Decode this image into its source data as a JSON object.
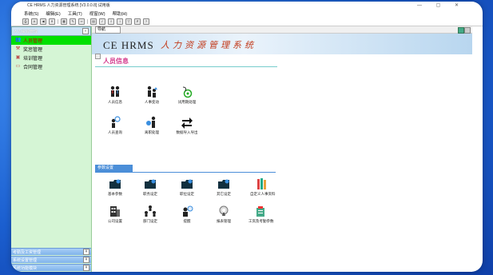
{
  "window": {
    "title": "CE HRMS 人力资源管理系统 [V3.0.0.8] 试用版",
    "controls": "— ▢ ✕"
  },
  "menu": [
    "系统(S)",
    "编辑(E)",
    "工具(T)",
    "视窗(W)",
    "帮助(H)"
  ],
  "toolbar": {
    "icons": [
      "print-icon",
      "font-icon",
      "back-icon",
      "close-icon",
      "grid-icon",
      "edit-icon",
      "link-icon",
      "calc-icon",
      "check-icon",
      "formula-icon",
      "sort-icon",
      "filter-icon",
      "delete-icon",
      "help-icon"
    ]
  },
  "sidebar": {
    "header": "人力资源管理",
    "toggle": "«",
    "items": [
      {
        "label": "人员管理",
        "icon": "people-icon",
        "selected": true
      },
      {
        "label": "奖惩管理",
        "icon": "hammer-icon",
        "selected": false
      },
      {
        "label": "培训管理",
        "icon": "training-icon",
        "selected": false
      },
      {
        "label": "合同管理",
        "icon": "contract-icon",
        "selected": false
      }
    ],
    "footers": [
      "考勤及工资管理",
      "系统设置管理",
      "系统功能模块"
    ],
    "footer_toggle": "¥"
  },
  "content": {
    "tab_label": "导航",
    "banner_logo": "CE HRMS",
    "banner_subtitle": "人力资源管理系统",
    "section1_title": "人员信息",
    "section1_items": [
      {
        "label": "人员信息",
        "icon": "staff-icon"
      },
      {
        "label": "人事变动",
        "icon": "transfer-icon"
      },
      {
        "label": "试用期处理",
        "icon": "probation-icon"
      },
      {
        "label": "人员查询",
        "icon": "search-people-icon"
      },
      {
        "label": "离职处理",
        "icon": "resign-icon"
      },
      {
        "label": "数据导入导出",
        "icon": "import-export-icon"
      }
    ],
    "section2_title": "参数设置",
    "section2_items": [
      {
        "label": "基本参数",
        "icon": "folder-icon"
      },
      {
        "label": "职务设定",
        "icon": "folder-icon"
      },
      {
        "label": "职位设定",
        "icon": "folder-icon"
      },
      {
        "label": "其它设定",
        "icon": "folder-icon"
      },
      {
        "label": "自定义人事资料",
        "icon": "books-icon"
      },
      {
        "label": "公司设置",
        "icon": "building-icon"
      },
      {
        "label": "部门设定",
        "icon": "org-icon"
      },
      {
        "label": "提醒",
        "icon": "reminder-icon"
      },
      {
        "label": "报表管理",
        "icon": "report-icon"
      },
      {
        "label": "工资及考勤参数",
        "icon": "salary-icon"
      }
    ]
  },
  "colors": {
    "sidebar_bg": "#d5f5d5",
    "selected_bg": "#00e000",
    "section_title": "#d33a8c",
    "section2_bar": "#4b8ed8"
  }
}
